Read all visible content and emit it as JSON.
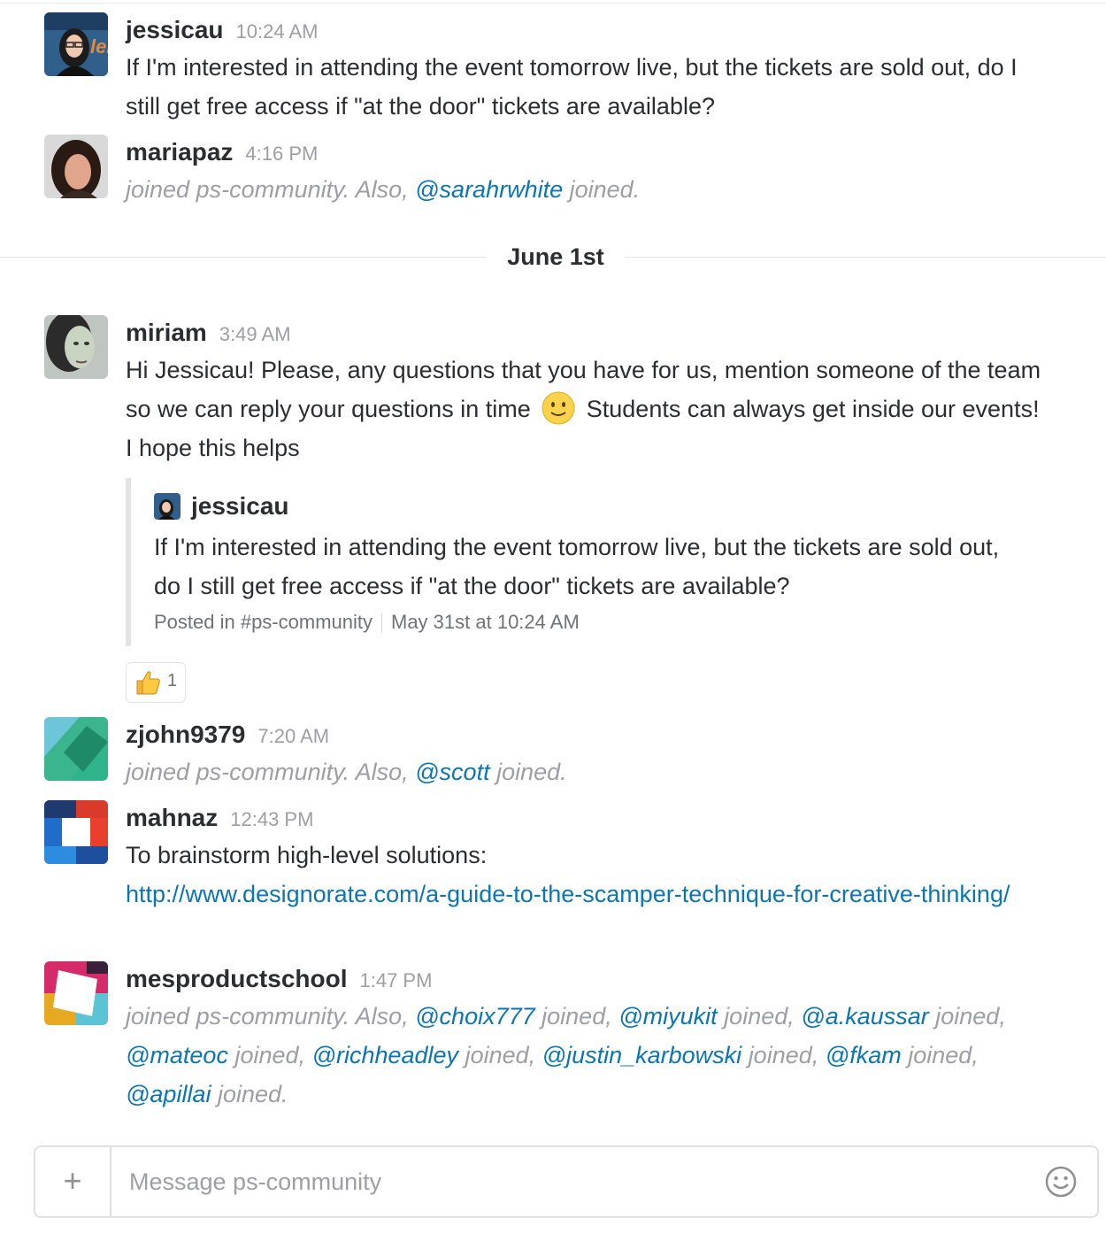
{
  "channel": "ps-community",
  "messages": [
    {
      "user": "jessicau",
      "time": "10:24 AM",
      "text": "If I'm interested in attending the event tomorrow live, but the tickets are sold out, do I still get free access if \"at the door\" tickets are available?"
    },
    {
      "user": "mariapaz",
      "time": "4:16 PM",
      "joined_text": "joined ps-community. Also,",
      "mention": "@sarahrwhite",
      "after": "joined."
    }
  ],
  "day_divider": "June 1st",
  "miriam": {
    "user": "miriam",
    "time": "3:49 AM",
    "text_a": "Hi Jessicau! Please, any questions that you have for us, mention someone of the team so we can reply your questions in time",
    "emoji": "slightly-smiling-face",
    "text_b": "Students can always get inside our events! I hope this helps",
    "quote": {
      "user": "jessicau",
      "text": "If I'm interested in attending the event tomorrow live, but the tickets are sold out, do I still get free access if \"at the door\" tickets are available?",
      "posted_in": "Posted in #ps-community",
      "date": "May 31st at 10:24 AM"
    },
    "reaction": {
      "emoji": "thumbs-up",
      "count": "1"
    }
  },
  "zjohn": {
    "user": "zjohn9379",
    "time": "7:20 AM",
    "joined_text": "joined ps-community. Also,",
    "mention": "@scott",
    "after": "joined."
  },
  "mahnaz": {
    "user": "mahnaz",
    "time": "12:43 PM",
    "text": "To brainstorm high-level solutions:",
    "link": "http://www.designorate.com/a-guide-to-the-scamper-technique-for-creative-thinking/"
  },
  "mes": {
    "user": "mesproductschool",
    "time": "1:47 PM",
    "joined_text": "joined ps-community. Also,",
    "mentions": [
      "@choix777",
      "@miyukit",
      "@a.kaussar",
      "@mateoc",
      "@richheadley",
      "@justin_karbowski",
      "@fkam",
      "@apillai"
    ],
    "sep": "joined,",
    "last": "joined."
  },
  "composer": {
    "placeholder": "Message ps-community",
    "plus": "+"
  },
  "colors": {
    "mention": "#0b76b5",
    "muted": "#9e9ea6",
    "text": "#2c2d30"
  }
}
